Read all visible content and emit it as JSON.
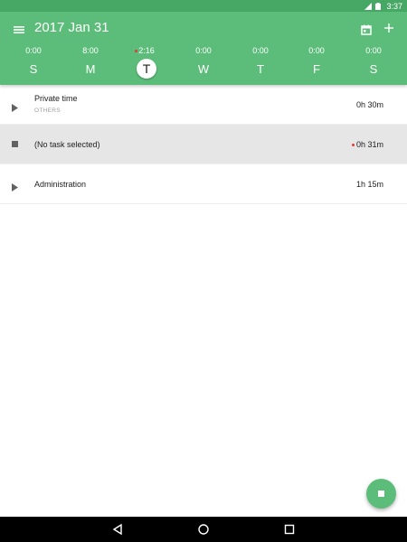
{
  "status_bar": {
    "time": "3:37",
    "icons": [
      "signal-icon",
      "battery-icon"
    ]
  },
  "app_bar": {
    "title": "2017 Jan 31",
    "menu_icon": "menu-icon",
    "calendar_icon": "calendar-icon",
    "add_icon": "add-icon",
    "background": "#5cbd7a"
  },
  "week": {
    "days": [
      {
        "letter": "S",
        "time": "0:00",
        "selected": false,
        "has_dot": false
      },
      {
        "letter": "M",
        "time": "8:00",
        "selected": false,
        "has_dot": false
      },
      {
        "letter": "T",
        "time": "2:16",
        "selected": true,
        "has_dot": true
      },
      {
        "letter": "W",
        "time": "0:00",
        "selected": false,
        "has_dot": false
      },
      {
        "letter": "T",
        "time": "0:00",
        "selected": false,
        "has_dot": false
      },
      {
        "letter": "F",
        "time": "0:00",
        "selected": false,
        "has_dot": false
      },
      {
        "letter": "S",
        "time": "0:00",
        "selected": false,
        "has_dot": false
      }
    ]
  },
  "tasks": [
    {
      "name": "Private time",
      "category": "OTHERS",
      "duration": "0h 30m",
      "state": "play",
      "running": false
    },
    {
      "name": "(No task selected)",
      "category": "",
      "duration": "0h 31m",
      "state": "stop",
      "running": true
    },
    {
      "name": "Administration",
      "category": "",
      "duration": "1h 15m",
      "state": "play",
      "running": false
    }
  ],
  "fab": {
    "icon": "stop-icon",
    "color": "#5cbd7a"
  },
  "nav_bar": {
    "buttons": [
      "back-icon",
      "home-icon",
      "recents-icon"
    ]
  },
  "colors": {
    "accent": "#5cbd7a",
    "status_bar": "#47a866",
    "running_dot": "#e53935",
    "active_row": "#e6e6e6"
  }
}
